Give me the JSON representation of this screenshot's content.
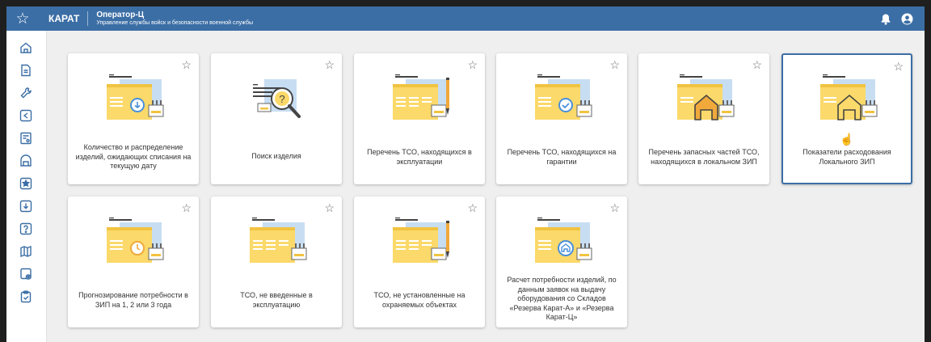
{
  "header": {
    "brand": "КАРАТ",
    "app_title": "Оператор-Ц",
    "app_subtitle": "Управление службы войск и безопасности военной службы",
    "favorites_icon": "star-outline-icon",
    "notifications_icon": "bell-icon",
    "user_icon": "account-circle-icon"
  },
  "sidebar": {
    "items": [
      {
        "name": "home-icon"
      },
      {
        "name": "document-icon"
      },
      {
        "name": "wrench-icon"
      },
      {
        "name": "return-icon"
      },
      {
        "name": "report-icon"
      },
      {
        "name": "archive-icon"
      },
      {
        "name": "star-box-icon"
      },
      {
        "name": "download-icon"
      },
      {
        "name": "help-box-icon"
      },
      {
        "name": "map-icon"
      },
      {
        "name": "settings-doc-icon"
      },
      {
        "name": "clipboard-icon"
      }
    ]
  },
  "cards": [
    {
      "label": "Количество и распределение изделий, ожидающих списания на текущую дату",
      "illustration": "download-folder"
    },
    {
      "label": "Поиск изделия",
      "illustration": "search-magnifier"
    },
    {
      "label": "Перечень ТСО, находящихся в эксплуатации",
      "illustration": "pen-folder"
    },
    {
      "label": "Перечень ТСО, находящихся на гарантии",
      "illustration": "check-folder"
    },
    {
      "label": "Перечень запасных частей ТСО, находящихся в локальном ЗИП",
      "illustration": "house-orange-folder"
    },
    {
      "label": "Показатели расходования Локального ЗИП",
      "illustration": "house-outline-folder"
    },
    {
      "label": "Прогнозирование потребности в ЗИП на 1, 2 или 3 года",
      "illustration": "clock-folder"
    },
    {
      "label": "ТСО, не введенные в эксплуатацию",
      "illustration": "plain-folder"
    },
    {
      "label": "ТСО, не установленные на охраняемых объектах",
      "illustration": "pen-folder"
    },
    {
      "label": "Расчет потребности изделий, по данным заявок на выдачу оборудования со Складов «Резерва Карат-А» и «Резерва Карат-Ц»",
      "illustration": "house-blue-folder"
    }
  ],
  "colors": {
    "accent": "#3b6ea5",
    "folder_yellow": "#fbd96a",
    "folder_blue": "#c7ddf2"
  }
}
